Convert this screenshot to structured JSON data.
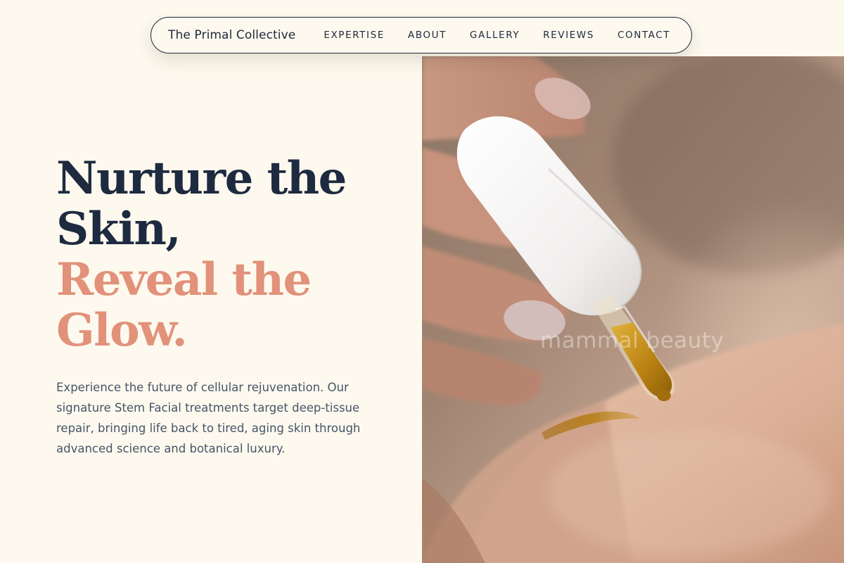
{
  "nav": {
    "brand": "The Primal Collective",
    "links": [
      "EXPERTISE",
      "ABOUT",
      "GALLERY",
      "REVIEWS",
      "CONTACT"
    ]
  },
  "hero": {
    "headline_dark": [
      "Nurture the",
      "Skin,"
    ],
    "headline_accent": [
      "Reveal the",
      "Glow."
    ],
    "description": "Experience the future of cellular rejuvenation. Our signature Stem Facial treatments target deep-tissue repair, bringing life back to tired, aging skin through advanced science and botanical luxury.",
    "image": {
      "subject": "serum-dropper-on-skin-photo",
      "watermark": "mammal beauty"
    }
  },
  "colors": {
    "background": "#fdf9ee",
    "heading_dark": "#1e2a40",
    "heading_accent": "#e2917a",
    "body_text": "#465468"
  }
}
